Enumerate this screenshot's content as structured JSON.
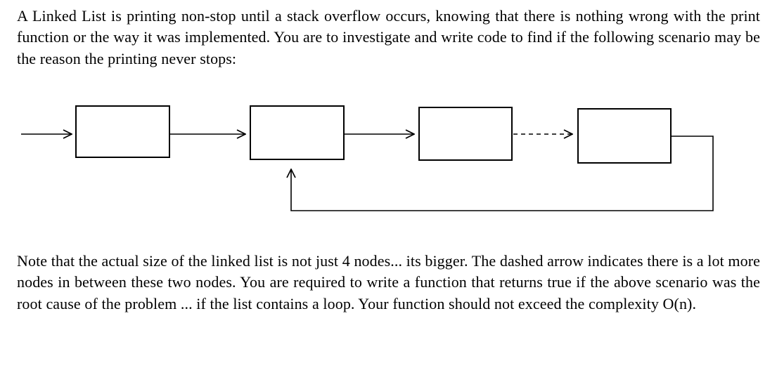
{
  "problem": {
    "paragraph1": "A Linked List is printing non-stop until a stack overflow occurs, knowing that there is nothing wrong with the print function or the way it was implemented. You are to investigate and write code to find if the following scenario may be the reason the printing never stops:",
    "paragraph2": "Note that the actual size of the linked list is not just 4 nodes... its bigger. The dashed arrow indicates there is a lot more nodes in between these two nodes. You are required to write a function that returns true if the above scenario was the root cause of the problem ... if the list contains a loop. Your function should not exceed the complexity O(n)."
  },
  "diagram": {
    "type": "linked-list-cycle",
    "description": "Four rectangular nodes connected left-to-right by solid arrows, with a dashed arrow between node 3 and node 4 indicating many omitted nodes, and a back-edge from node 4 down and leftward up into node 2 forming a cycle.",
    "nodes": [
      {
        "id": "node1",
        "label": ""
      },
      {
        "id": "node2",
        "label": ""
      },
      {
        "id": "node3",
        "label": ""
      },
      {
        "id": "node4",
        "label": ""
      }
    ],
    "edges": [
      {
        "from": "entry",
        "to": "node1",
        "style": "solid"
      },
      {
        "from": "node1",
        "to": "node2",
        "style": "solid"
      },
      {
        "from": "node2",
        "to": "node3",
        "style": "solid"
      },
      {
        "from": "node3",
        "to": "node4",
        "style": "dashed"
      },
      {
        "from": "node4",
        "to": "node2",
        "style": "solid",
        "back_edge": true
      }
    ]
  }
}
